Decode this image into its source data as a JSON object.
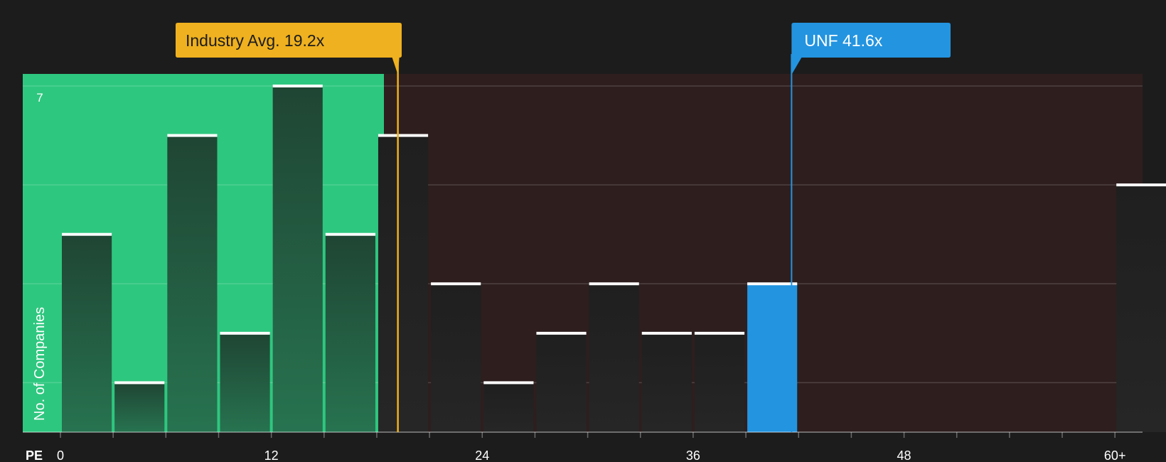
{
  "chart_data": {
    "type": "bar",
    "title": "",
    "xlabel": "PE",
    "ylabel": "No. of Companies",
    "x_ticks": [
      "0",
      "12",
      "24",
      "36",
      "48",
      "60+"
    ],
    "y_ticks": [
      "7"
    ],
    "ylim": [
      0,
      7
    ],
    "bin_width": 3,
    "bins": [
      {
        "from": 0,
        "to": 3,
        "value": 4
      },
      {
        "from": 3,
        "to": 6,
        "value": 1
      },
      {
        "from": 6,
        "to": 9,
        "value": 6
      },
      {
        "from": 9,
        "to": 12,
        "value": 2
      },
      {
        "from": 12,
        "to": 15,
        "value": 7
      },
      {
        "from": 15,
        "to": 18,
        "value": 4
      },
      {
        "from": 18,
        "to": 21,
        "value": 6
      },
      {
        "from": 21,
        "to": 24,
        "value": 3
      },
      {
        "from": 24,
        "to": 27,
        "value": 1
      },
      {
        "from": 27,
        "to": 30,
        "value": 2
      },
      {
        "from": 30,
        "to": 33,
        "value": 3
      },
      {
        "from": 33,
        "to": 36,
        "value": 2
      },
      {
        "from": 36,
        "to": 39,
        "value": 2
      },
      {
        "from": 39,
        "to": 42,
        "value": 3,
        "highlight": true
      },
      {
        "from": 60,
        "to": 63,
        "value": 5
      }
    ],
    "industry_avg": {
      "label": "Industry Avg. 19.2x",
      "value": 19.2
    },
    "company": {
      "label": "UNF 41.6x",
      "value": 41.6
    },
    "colors": {
      "background": "#1c1c1c",
      "undervalued_zone": "#2ec77f",
      "overvalued_zone": "#2e1e1e",
      "bar": "#222222",
      "bar_in_green": "#1f4a35",
      "highlight_bar": "#2394e0",
      "industry_marker": "#efb11f",
      "company_marker": "#2394e0",
      "bar_cap": "#ffffff",
      "text": "#ffffff"
    }
  }
}
